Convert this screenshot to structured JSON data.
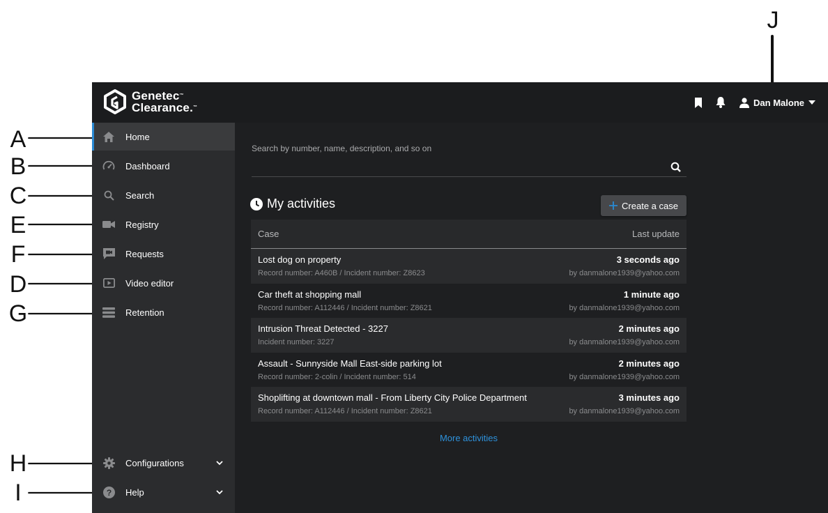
{
  "callouts": [
    "A",
    "B",
    "C",
    "E",
    "F",
    "D",
    "G",
    "H",
    "I",
    "J"
  ],
  "brand": {
    "line1": "Genetec",
    "line2": "Clearance.",
    "tm": "™"
  },
  "topbar": {
    "user_name": "Dan Malone"
  },
  "sidebar": {
    "items": [
      {
        "label": "Home",
        "icon": "home-icon"
      },
      {
        "label": "Dashboard",
        "icon": "gauge-icon"
      },
      {
        "label": "Search",
        "icon": "search-icon"
      },
      {
        "label": "Registry",
        "icon": "camera-icon"
      },
      {
        "label": "Requests",
        "icon": "request-icon"
      },
      {
        "label": "Video editor",
        "icon": "video-editor-icon"
      },
      {
        "label": "Retention",
        "icon": "retention-icon"
      }
    ],
    "bottom": [
      {
        "label": "Configurations",
        "icon": "gear-icon"
      },
      {
        "label": "Help",
        "icon": "help-icon"
      }
    ]
  },
  "search": {
    "label": "Search by number, name, description, and so on",
    "value": ""
  },
  "activities": {
    "title": "My activities",
    "create_label": "Create a case",
    "col_case": "Case",
    "col_update": "Last update",
    "rows": [
      {
        "title": "Lost dog on property",
        "sub": "Record number: A460B / Incident number: Z8623",
        "time": "3 seconds ago",
        "by": "by danmalone1939@yahoo.com"
      },
      {
        "title": "Car theft at shopping mall",
        "sub": "Record number: A112446 / Incident number: Z8621",
        "time": "1 minute ago",
        "by": "by danmalone1939@yahoo.com"
      },
      {
        "title": "Intrusion Threat Detected - 3227",
        "sub": "Incident number: 3227",
        "time": "2 minutes ago",
        "by": "by danmalone1939@yahoo.com"
      },
      {
        "title": "Assault - Sunnyside Mall East-side parking lot",
        "sub": "Record number: 2-colin / Incident number: 514",
        "time": "2 minutes ago",
        "by": "by danmalone1939@yahoo.com"
      },
      {
        "title": "Shoplifting at downtown mall - From Liberty City Police Department",
        "sub": "Record number: A112446 / Incident number: Z8621",
        "time": "3 minutes ago",
        "by": "by danmalone1939@yahoo.com"
      }
    ],
    "more_label": "More activities"
  },
  "colors": {
    "accent": "#2a8ad4",
    "link": "#2e92dc",
    "background": "#1e1f21",
    "sidebar": "#2b2c2e"
  }
}
